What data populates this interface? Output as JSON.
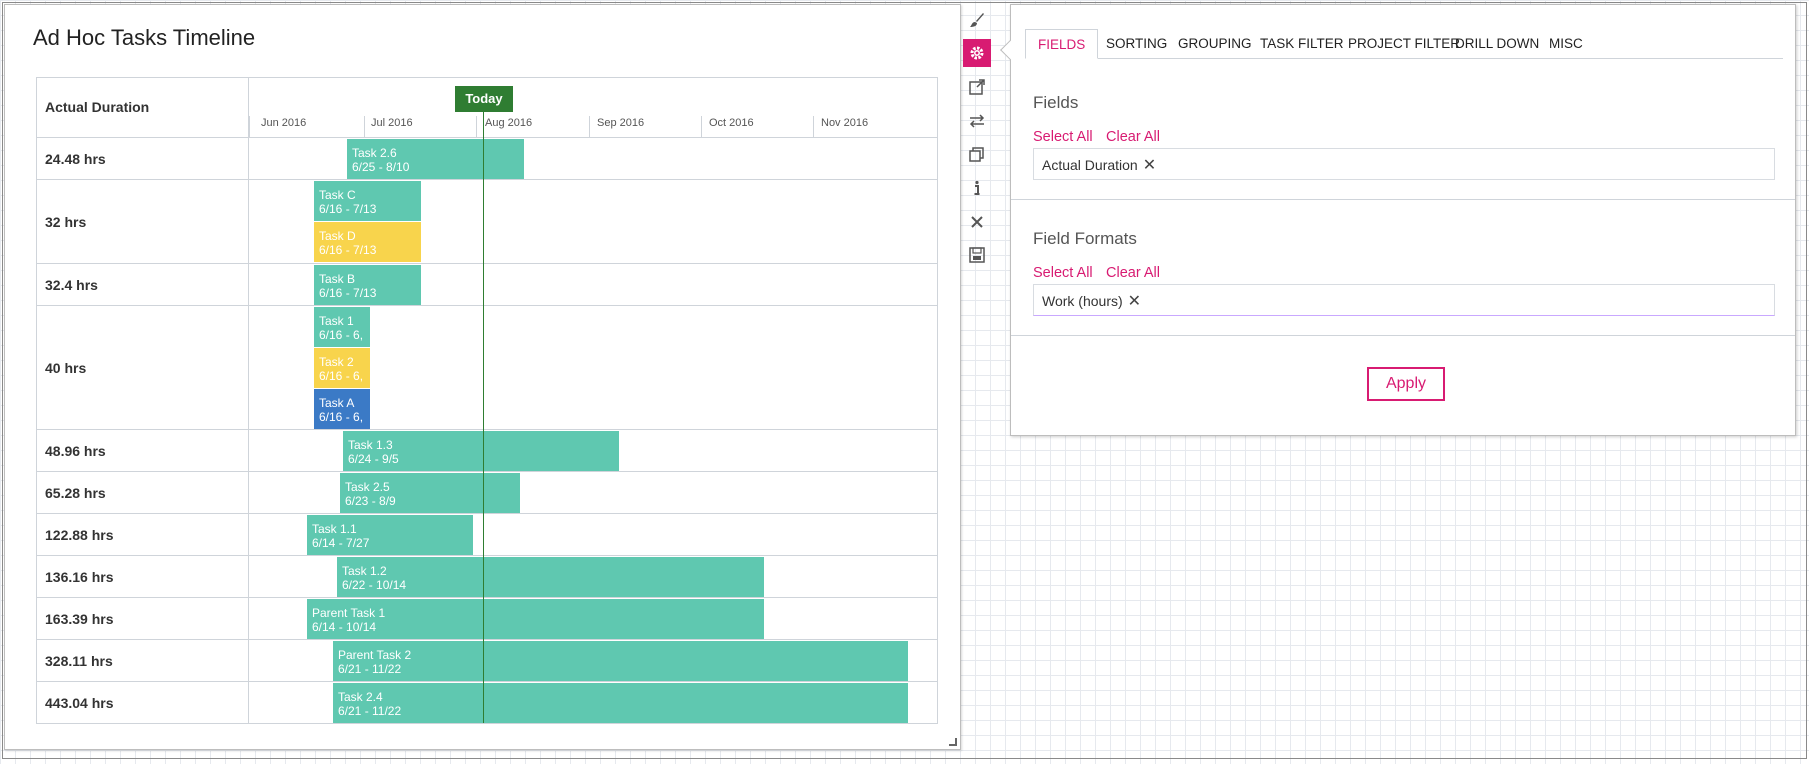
{
  "timeline": {
    "title": "Ad Hoc Tasks Timeline",
    "column_header": "Actual Duration",
    "today_label": "Today",
    "months": [
      "Jun 2016",
      "Jul 2016",
      "Aug 2016",
      "Sep 2016",
      "Oct 2016",
      "Nov 2016"
    ],
    "rows": [
      {
        "label": "24.48 hrs",
        "tasks": [
          {
            "name": "Task 2.6",
            "dates": "6/25 - 8/10",
            "color": "#5fc8b0"
          }
        ]
      },
      {
        "label": "32 hrs",
        "tasks": [
          {
            "name": "Task C",
            "dates": "6/16 - 7/13",
            "color": "#5fc8b0"
          },
          {
            "name": "Task D",
            "dates": "6/16 - 7/13",
            "color": "#f8d44c"
          }
        ]
      },
      {
        "label": "32.4 hrs",
        "tasks": [
          {
            "name": "Task B",
            "dates": "6/16 - 7/13",
            "color": "#5fc8b0"
          }
        ]
      },
      {
        "label": "40 hrs",
        "tasks": [
          {
            "name": "Task 1",
            "dates": "6/16 - 6,",
            "color": "#5fc8b0"
          },
          {
            "name": "Task 2",
            "dates": "6/16 - 6,",
            "color": "#f8d44c"
          },
          {
            "name": "Task A",
            "dates": "6/16 - 6,",
            "color": "#3b7ac6"
          }
        ]
      },
      {
        "label": "48.96 hrs",
        "tasks": [
          {
            "name": "Task 1.3",
            "dates": "6/24 - 9/5",
            "color": "#5fc8b0"
          }
        ]
      },
      {
        "label": "65.28 hrs",
        "tasks": [
          {
            "name": "Task 2.5",
            "dates": "6/23 - 8/9",
            "color": "#5fc8b0"
          }
        ]
      },
      {
        "label": "122.88 hrs",
        "tasks": [
          {
            "name": "Task 1.1",
            "dates": "6/14 - 7/27",
            "color": "#5fc8b0"
          }
        ]
      },
      {
        "label": "136.16 hrs",
        "tasks": [
          {
            "name": "Task 1.2",
            "dates": "6/22 - 10/14",
            "color": "#5fc8b0"
          }
        ]
      },
      {
        "label": "163.39 hrs",
        "tasks": [
          {
            "name": "Parent Task 1",
            "dates": "6/14 - 10/14",
            "color": "#5fc8b0"
          }
        ]
      },
      {
        "label": "328.11 hrs",
        "tasks": [
          {
            "name": "Parent Task 2",
            "dates": "6/21 - 11/22",
            "color": "#5fc8b0"
          }
        ]
      },
      {
        "label": "443.04 hrs",
        "tasks": [
          {
            "name": "Task 2.4",
            "dates": "6/21 - 11/22",
            "color": "#5fc8b0"
          }
        ]
      }
    ]
  },
  "toolbar": {
    "icons": [
      "brush-icon",
      "gear-icon",
      "popout-icon",
      "swap-icon",
      "copy-icon",
      "info-icon",
      "close-icon",
      "save-icon"
    ],
    "active": "gear-icon",
    "accent_color": "#d81b72"
  },
  "settings": {
    "tabs": [
      "FIELDS",
      "SORTING",
      "GROUPING",
      "TASK FILTER",
      "PROJECT FILTER",
      "DRILL DOWN",
      "MISC"
    ],
    "active_tab": "FIELDS",
    "fields": {
      "title": "Fields",
      "select_all": "Select All",
      "clear_all": "Clear All",
      "chips": [
        "Actual Duration"
      ]
    },
    "field_formats": {
      "title": "Field Formats",
      "select_all": "Select All",
      "clear_all": "Clear All",
      "chips": [
        "Work (hours)"
      ]
    },
    "apply_label": "Apply"
  }
}
